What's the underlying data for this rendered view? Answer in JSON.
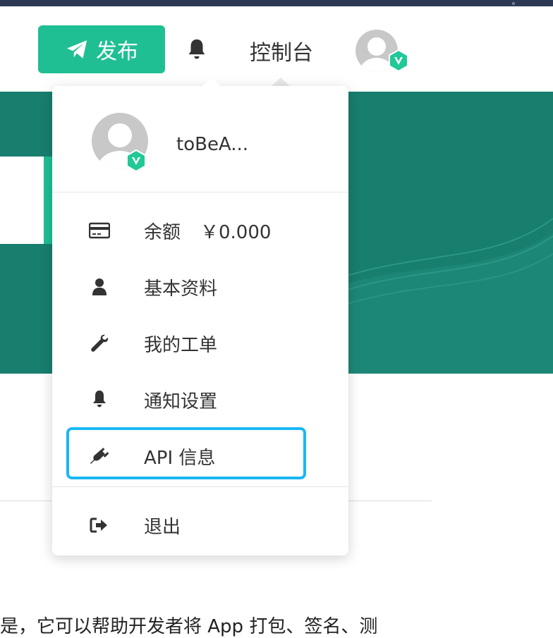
{
  "navbar": {
    "publish_label": "发布",
    "console_label": "控制台"
  },
  "account_menu": {
    "username": "toBeA...",
    "items": [
      {
        "icon": "credit-card-icon",
        "label": "余额",
        "value": "￥0.000"
      },
      {
        "icon": "user-icon",
        "label": "基本资料"
      },
      {
        "icon": "wrench-icon",
        "label": "我的工单"
      },
      {
        "icon": "bell-icon",
        "label": "通知设置"
      },
      {
        "icon": "plug-icon",
        "label": "API 信息"
      },
      {
        "icon": "sign-out-icon",
        "label": "退出"
      }
    ]
  },
  "page": {
    "bottom_text": "是，它可以帮助开发者将 App 打包、签名、测"
  },
  "colors": {
    "accent": "#1fbf93",
    "hero": "#187e6e",
    "highlight": "#1ab7f5"
  }
}
